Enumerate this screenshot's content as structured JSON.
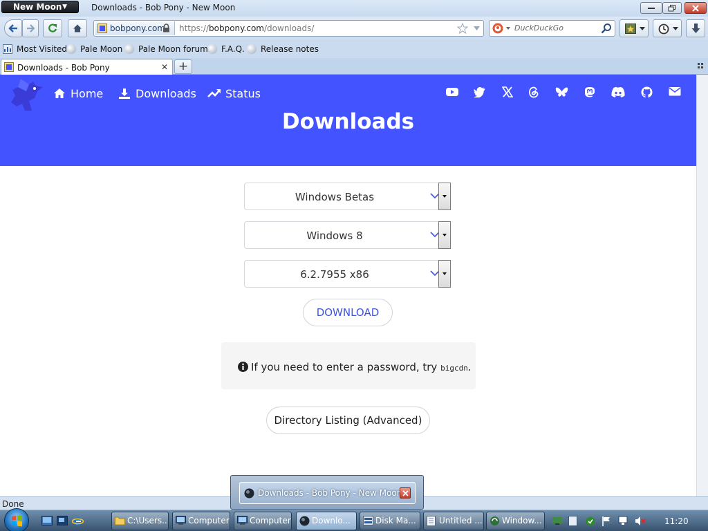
{
  "window": {
    "app_button": "New Moon",
    "title": "Downloads - Bob Pony - New Moon"
  },
  "toolbar": {
    "identity": "bobpony.com",
    "url_prefix": "https://",
    "url_host": "bobpony.com",
    "url_path": "/downloads/",
    "search_placeholder": "DuckDuckGo"
  },
  "bookmarks": [
    {
      "label": "Most Visited"
    },
    {
      "label": "Pale Moon"
    },
    {
      "label": "Pale Moon forum"
    },
    {
      "label": "F.A.Q."
    },
    {
      "label": "Release notes"
    }
  ],
  "tab": {
    "label": "Downloads - Bob Pony"
  },
  "site": {
    "nav": [
      {
        "label": "Home",
        "icon": "home-icon"
      },
      {
        "label": "Downloads",
        "icon": "download-icon"
      },
      {
        "label": "Status",
        "icon": "trend-icon"
      }
    ],
    "social_icons": [
      "youtube-icon",
      "twitter-icon",
      "x-icon",
      "threads-icon",
      "bluesky-icon",
      "mastodon-icon",
      "discord-icon",
      "github-icon",
      "email-icon"
    ],
    "heading": "Downloads",
    "selects": [
      {
        "value": "Windows Betas"
      },
      {
        "value": "Windows 8"
      },
      {
        "value": "6.2.7955 x86"
      }
    ],
    "download_button": "DOWNLOAD",
    "notice_text": "If you need to enter a password, try ",
    "notice_code": "bigcdn",
    "notice_end": ".",
    "dirlist_button": "Directory Listing (Advanced)",
    "brand_color": "#4353ff"
  },
  "status": {
    "text": "Done"
  },
  "thumbnail": {
    "label": "Downloads - Bob Pony - New Moon"
  },
  "taskbar": {
    "tasks": [
      {
        "label": "C:\\Users..."
      },
      {
        "label": "Computer"
      },
      {
        "label": "Computer"
      },
      {
        "label": "Downlo..."
      },
      {
        "label": "Disk Ma..."
      },
      {
        "label": "Untitled ..."
      },
      {
        "label": "Window..."
      }
    ],
    "clock": "11:20"
  }
}
